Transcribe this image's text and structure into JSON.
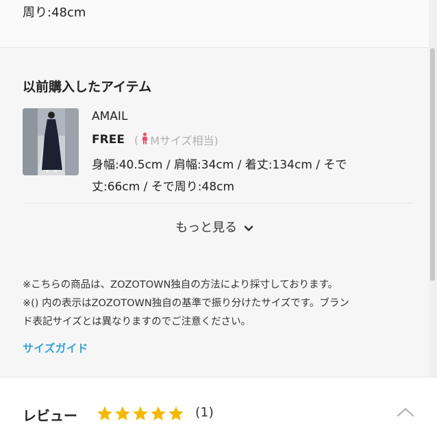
{
  "top": {
    "measure_tail": "周り:48cm"
  },
  "purchased": {
    "title": "以前購入したアイテム",
    "item": {
      "brand": "AMAIL",
      "size": "FREE",
      "size_hint_open": "(",
      "size_hint_text": "Mサイズ相当)",
      "spec_line1": "身幅:40.5cm / 肩幅:34cm / 着丈:134cm / そで",
      "spec_line2": "丈:66cm / そで周り:48cm"
    },
    "more_label": "もっと見る"
  },
  "notes": [
    "※こちらの商品は、ZOZOTOWN独自の方法により採寸しております。",
    "※() 内の表示はZOZOTOWN独自の基準で振り分けたサイズです。ブラン",
    "ド表記サイズとは異なりますのでご注意ください。"
  ],
  "size_guide_label": "サイズガイド",
  "review": {
    "title": "レビュー",
    "rating": 5,
    "max_rating": 5,
    "count": "(1)"
  },
  "colors": {
    "link": "#3aa1d8",
    "star": "#f5b800",
    "person_icon": "#e0526b"
  },
  "icons": {
    "person": "person-icon",
    "more": "chevron-down-icon",
    "collapse": "chevron-up-icon",
    "star": "star-icon"
  }
}
